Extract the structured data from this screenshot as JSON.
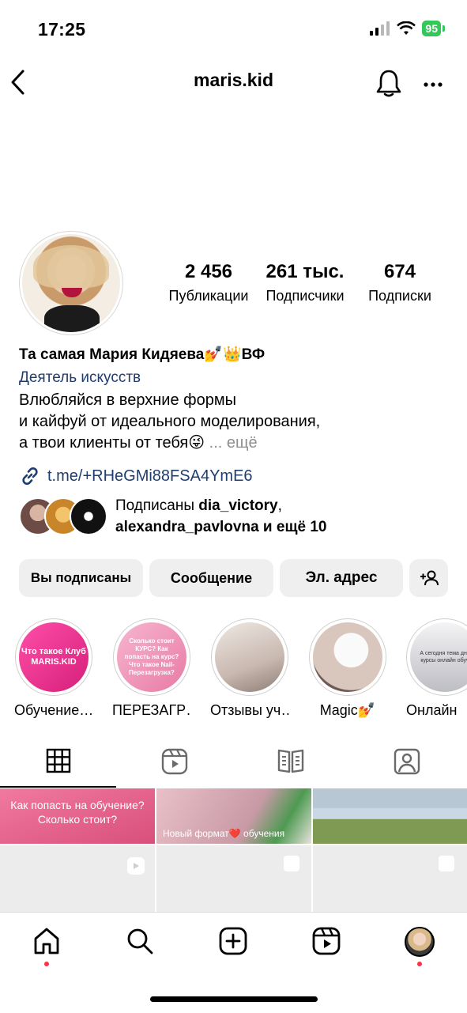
{
  "status": {
    "time": "17:25",
    "battery": "95"
  },
  "header": {
    "username": "maris.kid"
  },
  "stats": [
    {
      "number": "2 456",
      "label": "Публикации"
    },
    {
      "number": "261 тыс.",
      "label": "Подписчики"
    },
    {
      "number": "674",
      "label": "Подписки"
    }
  ],
  "profile": {
    "name": "Та самая Мария Кидяева💅👑ВФ",
    "category": "Деятель искусств",
    "bio_lines": [
      "Влюбляйся в верхние формы",
      "и кайфуй от идеального моделирования,",
      "а твои клиенты от тебя😜"
    ],
    "bio_more": "... ещё",
    "link": "t.me/+RHeGMi88FSA4YmE6"
  },
  "followed_by": {
    "prefix": "Подписаны ",
    "user1": "dia_victory",
    "sep": ",",
    "user2": "alexandra_pavlovna",
    "suffix": " и ещё 10"
  },
  "buttons": {
    "following": "Вы подписаны",
    "message": "Сообщение",
    "email": "Эл. адрес"
  },
  "highlights": [
    {
      "label": "Обучение…",
      "cover_text": "Что такое Клуб MARIS.KID",
      "color": "#e8388e"
    },
    {
      "label": "ПЕРЕЗАГР…",
      "cover_text": "Сколько стоит КУРС? Как попасть на курс? Что такое Nail-Перезагрузка?",
      "color": "#f0a7c2"
    },
    {
      "label": "Отзывы уч…",
      "cover_text": "",
      "color": "#d9d3cf"
    },
    {
      "label": "Magic💅",
      "cover_text": "",
      "color": "#d8cbc4"
    },
    {
      "label": "Онлайн",
      "cover_text": "А сегодня тема дня курсы онлайн обуч",
      "color": "#c9c9cc"
    }
  ],
  "grid": {
    "posts": [
      {
        "caption": "Как попасть на обучение? Сколько стоит?",
        "color": "#e0708f"
      },
      {
        "caption": "Новый формат❤️ обучения",
        "color": "#d4a6b1"
      },
      {
        "caption": "",
        "color": "#9bb07a"
      }
    ]
  },
  "colors": {
    "link": "#1f3d6f",
    "button_bg": "#efefef",
    "battery": "#34c759",
    "notification": "#ff3040"
  }
}
